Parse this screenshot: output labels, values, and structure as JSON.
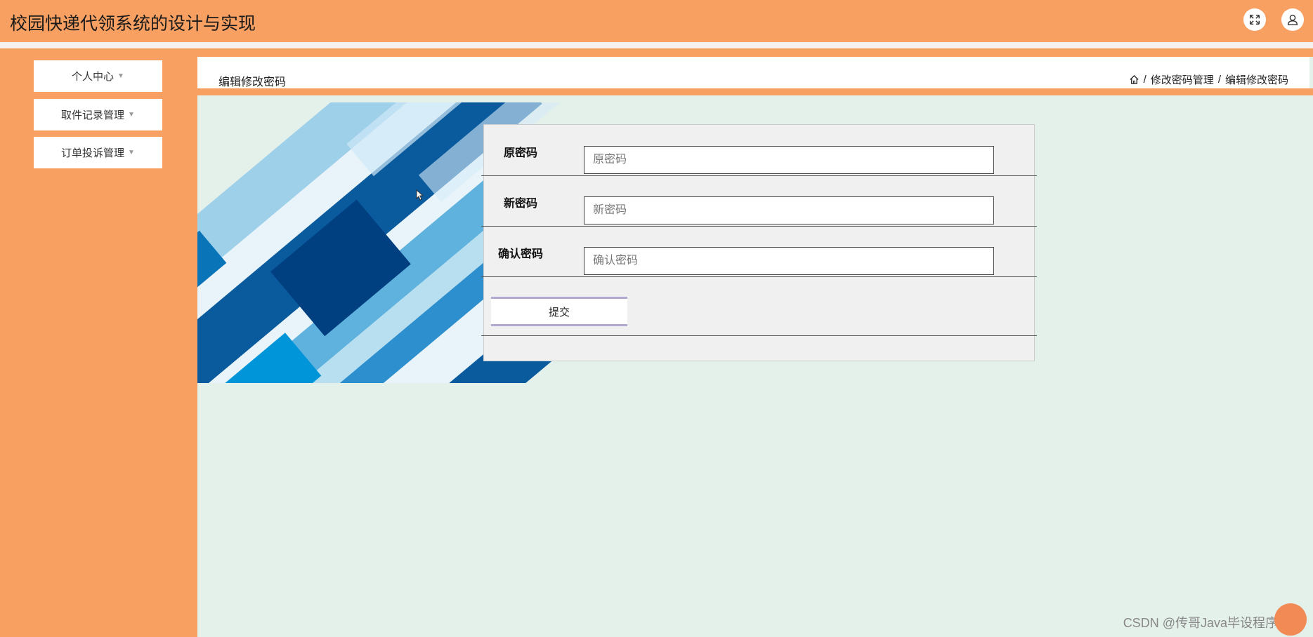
{
  "header": {
    "title": "校园快递代领系统的设计与实现"
  },
  "sidebar": {
    "items": [
      {
        "label": "个人中心"
      },
      {
        "label": "取件记录管理"
      },
      {
        "label": "订单投诉管理"
      }
    ]
  },
  "page": {
    "title": "编辑修改密码",
    "breadcrumb": [
      "修改密码管理",
      "编辑修改密码"
    ]
  },
  "form": {
    "fields": [
      {
        "label": "原密码",
        "placeholder": "原密码"
      },
      {
        "label": "新密码",
        "placeholder": "新密码"
      },
      {
        "label": "确认密码",
        "placeholder": "确认密码"
      }
    ],
    "submit_label": "提交"
  },
  "watermark": "CSDN @传哥Java毕设程序设计",
  "colors": {
    "accent": "#f8a062",
    "background": "#e4f0ea",
    "panel": "#f0f0f0",
    "button_border": "#b3a9cf"
  }
}
